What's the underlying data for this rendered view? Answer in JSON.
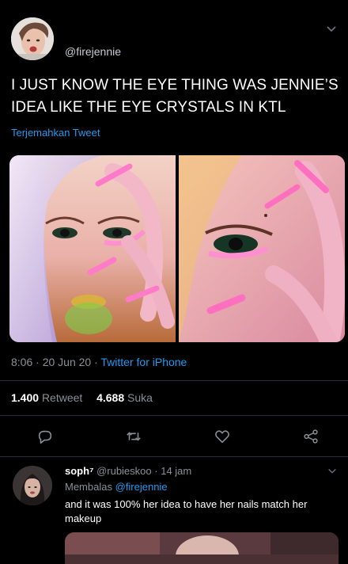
{
  "tweet": {
    "handle": "@firejennie",
    "text": "I JUST KNOW THE EYE THING WAS JENNIE’S IDEA LIKE THE EYE CRYSTALS IN KTL",
    "translate_label": "Terjemahkan Tweet",
    "time": "8:06",
    "date": "20 Jun 20",
    "source": "Twitter for iPhone",
    "retweets_count": "1.400",
    "retweets_label": "Retweet",
    "likes_count": "4.688",
    "likes_label": "Suka"
  },
  "icons": {
    "more": "chevron-down-icon",
    "reply": "comment-icon",
    "retweet": "retweet-icon",
    "like": "heart-icon",
    "share": "share-icon"
  },
  "reply": {
    "name": "soph",
    "badge": "⁷",
    "handle": "@rubieskoo",
    "time": "14 jam",
    "replying_label": "Membalas",
    "replying_to": "@firejennie",
    "text": "and it was 100% her idea to have her nails match her makeup"
  },
  "colors": {
    "background": "#000000",
    "accent": "#1d9bf0",
    "muted": "#8b9097",
    "divider": "#2a2e33"
  }
}
